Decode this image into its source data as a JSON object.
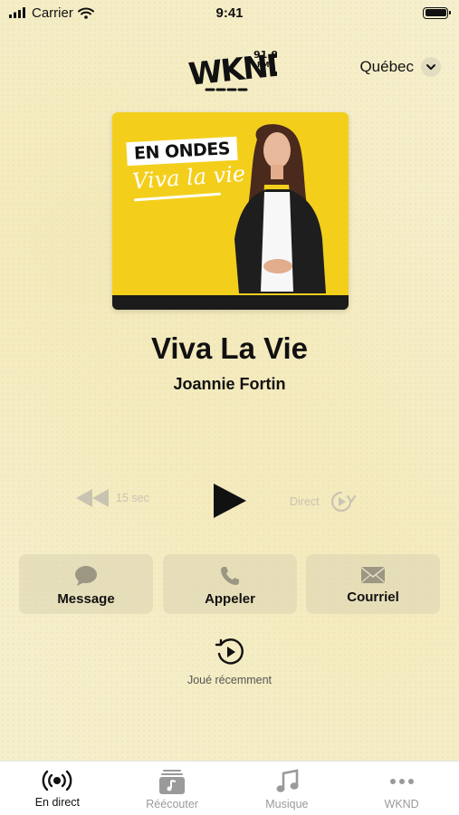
{
  "status_bar": {
    "carrier": "Carrier",
    "time": "9:41"
  },
  "header": {
    "logo_text": "WKND",
    "logo_freq": "91.9",
    "logo_fm": "FM",
    "region": "Québec"
  },
  "artwork": {
    "tag_line1": "EN ONDES",
    "tag_line2": "Viva la vie"
  },
  "now_playing": {
    "title": "Viva La Vie",
    "host": "Joannie Fortin"
  },
  "player": {
    "rewind_label": "15 sec",
    "live_label": "Direct"
  },
  "actions": [
    {
      "label": "Message",
      "icon": "speech-bubble-icon"
    },
    {
      "label": "Appeler",
      "icon": "phone-icon"
    },
    {
      "label": "Courriel",
      "icon": "envelope-icon"
    }
  ],
  "recent": {
    "label": "Joué récemment",
    "icon": "history-play-icon"
  },
  "tabs": [
    {
      "label": "En direct",
      "icon": "broadcast-icon",
      "active": true
    },
    {
      "label": "Réécouter",
      "icon": "replay-list-icon",
      "active": false
    },
    {
      "label": "Musique",
      "icon": "music-note-icon",
      "active": false
    },
    {
      "label": "WKND",
      "icon": "more-dots-icon",
      "active": false
    }
  ],
  "colors": {
    "background": "#f6efcd",
    "artwork_yellow": "#f3cf1c",
    "inactive": "#c9c4b1",
    "tab_inactive": "#9a9a9a"
  }
}
